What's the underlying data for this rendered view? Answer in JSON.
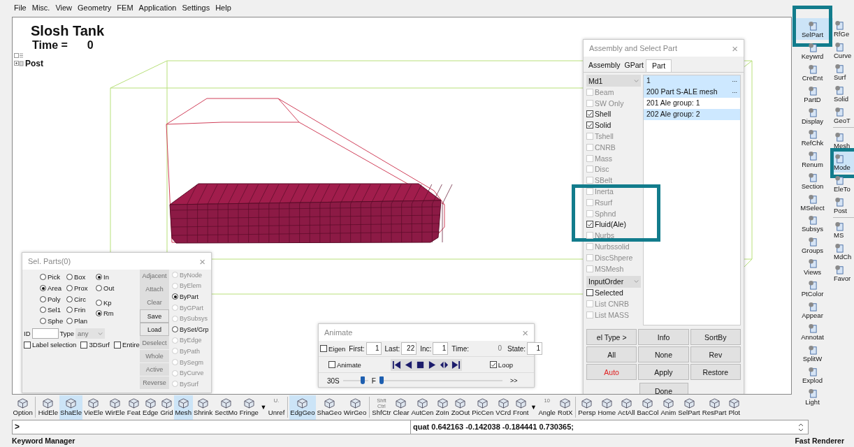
{
  "menu": [
    "File",
    "Misc.",
    "View",
    "Geometry",
    "FEM",
    "Application",
    "Settings",
    "Help"
  ],
  "viewport": {
    "title": "Slosh Tank",
    "time_label": "Time =",
    "time_value": "0",
    "tree_label": "Post"
  },
  "sel_parts": {
    "title": "Sel. Parts(0)",
    "close": "×",
    "methods": [
      {
        "label": "Pick",
        "selected": false
      },
      {
        "label": "Box",
        "selected": false
      },
      {
        "label": "Area",
        "selected": true
      },
      {
        "label": "Prox",
        "selected": false
      },
      {
        "label": "Poly",
        "selected": false
      },
      {
        "label": "Circ",
        "selected": false
      },
      {
        "label": "Sel1",
        "selected": false
      },
      {
        "label": "Frin",
        "selected": false
      },
      {
        "label": "Sphe",
        "selected": false
      },
      {
        "label": "Plan",
        "selected": false
      }
    ],
    "region": [
      {
        "label": "In",
        "selected": true
      },
      {
        "label": "Out",
        "selected": false
      }
    ],
    "keep": [
      {
        "label": "Kp",
        "selected": false
      },
      {
        "label": "Rm",
        "selected": true
      }
    ],
    "id_label": "ID",
    "type_label": "Type",
    "type_value": "any",
    "type_disabled": true,
    "checks": [
      {
        "label": "Label selection",
        "checked": false
      },
      {
        "label": "3DSurf",
        "checked": false
      },
      {
        "label": "Entire",
        "checked": false
      }
    ],
    "buttons": [
      {
        "label": "Adjacent",
        "disabled": true
      },
      {
        "label": "Attach",
        "disabled": true
      },
      {
        "label": "Clear",
        "disabled": true
      },
      {
        "label": "Save",
        "disabled": false
      },
      {
        "label": "Load",
        "disabled": false
      },
      {
        "label": "Deselect",
        "disabled": true
      },
      {
        "label": "Whole",
        "disabled": true
      },
      {
        "label": "Active",
        "disabled": true
      },
      {
        "label": "Reverse",
        "disabled": true
      }
    ],
    "by": [
      {
        "label": "ByNode",
        "selected": false,
        "disabled": true
      },
      {
        "label": "ByElem",
        "selected": false,
        "disabled": true
      },
      {
        "label": "ByPart",
        "selected": true,
        "disabled": false
      },
      {
        "label": "ByGPart",
        "selected": false,
        "disabled": true
      },
      {
        "label": "BySubsys",
        "selected": false,
        "disabled": true
      },
      {
        "label": "BySet/Grp",
        "selected": false,
        "disabled": false
      },
      {
        "label": "ByEdge",
        "selected": false,
        "disabled": true
      },
      {
        "label": "ByPath",
        "selected": false,
        "disabled": true
      },
      {
        "label": "BySegm",
        "selected": false,
        "disabled": true
      },
      {
        "label": "ByCurve",
        "selected": false,
        "disabled": true
      },
      {
        "label": "BySurf",
        "selected": false,
        "disabled": true
      }
    ]
  },
  "animate": {
    "title": "Animate",
    "close": "×",
    "eigen": {
      "label": "Eigen",
      "checked": false
    },
    "fields": [
      {
        "label": "First:",
        "value": "1",
        "disabled": false
      },
      {
        "label": "Last:",
        "value": "22",
        "disabled": false
      },
      {
        "label": "Inc:",
        "value": "1",
        "disabled": false
      },
      {
        "label": "Time:",
        "value": "0",
        "disabled": true
      },
      {
        "label": "State:",
        "value": "1",
        "disabled": false
      }
    ],
    "animate_check": {
      "label": "Animate",
      "checked": false
    },
    "loop": {
      "label": "Loop",
      "checked": true
    },
    "speed": {
      "label": "30S",
      "level": 0.85
    },
    "frame": {
      "label": "F",
      "level": 0.0
    },
    "more": ">>"
  },
  "assembly": {
    "title": "Assembly and Select Part",
    "close": "×",
    "tabs": [
      {
        "label": "Assembly",
        "selected": false
      },
      {
        "label": "GPart",
        "selected": false
      },
      {
        "label": "Part",
        "selected": true
      }
    ],
    "model": "Md1",
    "types": [
      {
        "label": "Beam",
        "checked": false,
        "disabled": true,
        "highlighted": false
      },
      {
        "label": "SW Only",
        "checked": false,
        "disabled": true,
        "highlighted": false
      },
      {
        "label": "Shell",
        "checked": true,
        "disabled": false,
        "highlighted": false
      },
      {
        "label": "Solid",
        "checked": true,
        "disabled": false,
        "highlighted": false
      },
      {
        "label": "Tshell",
        "checked": false,
        "disabled": true,
        "highlighted": false
      },
      {
        "label": "CNRB",
        "checked": false,
        "disabled": true,
        "highlighted": false
      },
      {
        "label": "Mass",
        "checked": false,
        "disabled": true,
        "highlighted": false
      },
      {
        "label": "Disc",
        "checked": false,
        "disabled": true,
        "highlighted": false
      },
      {
        "label": "SBelt",
        "checked": false,
        "disabled": true,
        "highlighted": false
      },
      {
        "label": "Inerta",
        "checked": false,
        "disabled": true,
        "highlighted": false
      },
      {
        "label": "Rsurf",
        "checked": false,
        "disabled": true,
        "highlighted": false
      },
      {
        "label": "Sphnd",
        "checked": false,
        "disabled": true,
        "highlighted": false
      },
      {
        "label": "Fluid(Ale)",
        "checked": true,
        "disabled": false,
        "highlighted": true
      },
      {
        "label": "Nurbs",
        "checked": false,
        "disabled": true,
        "highlighted": false
      },
      {
        "label": "Nurbssolid",
        "checked": false,
        "disabled": true,
        "highlighted": false
      },
      {
        "label": "DiscShpere",
        "checked": false,
        "disabled": true,
        "highlighted": false
      },
      {
        "label": "MSMesh",
        "checked": false,
        "disabled": true,
        "highlighted": false
      }
    ],
    "order": "InputOrder",
    "list_options": [
      {
        "label": "Selected",
        "checked": false,
        "disabled": false
      },
      {
        "label": "List CNRB",
        "checked": false,
        "disabled": true
      },
      {
        "label": "List MASS",
        "checked": false,
        "disabled": true
      }
    ],
    "parts": [
      {
        "label": "1",
        "more": "...",
        "selected": true
      },
      {
        "label": "200 Part S-ALE mesh",
        "more": "...",
        "selected": true
      },
      {
        "label": "201 Ale group: 1",
        "selected": false
      },
      {
        "label": "202 Ale group: 2",
        "selected": true
      }
    ],
    "buttons": [
      {
        "label": "el Type >",
        "alert": false
      },
      {
        "label": "Info",
        "alert": false
      },
      {
        "label": "SortBy",
        "alert": false
      },
      {
        "label": "All",
        "alert": false
      },
      {
        "label": "None",
        "alert": false
      },
      {
        "label": "Rev",
        "alert": false
      },
      {
        "label": "Auto",
        "alert": true
      },
      {
        "label": "Apply",
        "alert": false
      },
      {
        "label": "Restore",
        "alert": false
      }
    ],
    "done": "Done"
  },
  "side_toolbar": [
    [
      [
        {
          "label": "SelPart",
          "selected": true,
          "highlighted": true
        },
        {
          "label": "Keywrd",
          "selected": false,
          "highlighted": false
        },
        {
          "label": "CreEnt",
          "selected": false,
          "highlighted": false
        },
        {
          "label": "PartD",
          "selected": false,
          "highlighted": false
        },
        {
          "label": "Display",
          "selected": false,
          "highlighted": false
        },
        {
          "label": "RefChk",
          "selected": false,
          "highlighted": false
        },
        {
          "label": "Renum",
          "selected": false,
          "highlighted": false
        },
        {
          "label": "Section",
          "selected": false,
          "highlighted": false
        },
        {
          "label": "MSelect",
          "selected": false,
          "highlighted": false
        },
        {
          "label": "Subsys",
          "selected": false,
          "highlighted": false
        },
        {
          "label": "Groups",
          "selected": false,
          "highlighted": false
        },
        {
          "label": "Views",
          "selected": false,
          "highlighted": false
        },
        {
          "label": "PtColor",
          "selected": false,
          "highlighted": false
        },
        {
          "label": "Appear",
          "selected": false,
          "highlighted": false
        },
        {
          "label": "Annotat",
          "selected": false,
          "highlighted": false
        },
        {
          "label": "SplitW",
          "selected": false,
          "highlighted": false
        },
        {
          "label": "Explod",
          "selected": false,
          "highlighted": false
        },
        {
          "label": "Light",
          "selected": false,
          "highlighted": false
        }
      ]
    ],
    [
      [
        {
          "label": "RfGe",
          "selected": false,
          "highlighted": false
        },
        {
          "label": "Curve",
          "selected": false,
          "highlighted": false
        },
        {
          "label": "Surf",
          "selected": false,
          "highlighted": false
        },
        {
          "label": "Solid",
          "selected": false,
          "highlighted": false
        },
        {
          "label": "GeoT",
          "selected": false,
          "highlighted": false
        }
      ],
      [
        {
          "label": "Mesh",
          "selected": false,
          "highlighted": false
        },
        {
          "label": "Mode",
          "selected": true,
          "highlighted": true
        },
        {
          "label": "EleTo",
          "selected": false,
          "highlighted": false
        },
        {
          "label": "Post",
          "selected": false,
          "highlighted": false
        }
      ],
      [
        {
          "label": "MS",
          "selected": false,
          "highlighted": false
        },
        {
          "label": "MdCh",
          "selected": false,
          "highlighted": false
        },
        {
          "label": "Favor",
          "selected": false,
          "highlighted": false
        }
      ]
    ]
  ],
  "bottom_toolbar": [
    [
      {
        "kind": "tool",
        "label": "Option",
        "selected": false
      }
    ],
    [
      {
        "kind": "tool",
        "label": "HidEle",
        "selected": false
      },
      {
        "kind": "tool",
        "label": "ShaEle",
        "selected": true
      },
      {
        "kind": "tool",
        "label": "VieEle",
        "selected": false
      },
      {
        "kind": "tool",
        "label": "WirEle",
        "selected": false
      },
      {
        "kind": "tool",
        "label": "Feat",
        "selected": false
      },
      {
        "kind": "tool",
        "label": "Edge",
        "selected": false
      },
      {
        "kind": "tool",
        "label": "Grid",
        "selected": false
      },
      {
        "kind": "tool",
        "label": "Mesh",
        "selected": true
      },
      {
        "kind": "tool",
        "label": "Shrink",
        "selected": false
      },
      {
        "kind": "tool",
        "label": "SectMo",
        "selected": false
      },
      {
        "kind": "tool",
        "label": "Fringe",
        "selected": false
      },
      {
        "kind": "dropdown",
        "label": "▼",
        "selected": false
      },
      {
        "kind": "tool",
        "label": "Unref",
        "icon_text": "U.",
        "selected": false
      }
    ],
    [
      {
        "kind": "tool",
        "label": "EdgGeo",
        "selected": true
      },
      {
        "kind": "tool",
        "label": "ShaGeo",
        "selected": false
      },
      {
        "kind": "tool",
        "label": "WirGeo",
        "selected": false
      }
    ],
    [
      {
        "kind": "tool",
        "label": "ShfCtr",
        "icon_text": "Shft Ctrl",
        "selected": false
      },
      {
        "kind": "tool",
        "label": "Clear",
        "selected": false
      },
      {
        "kind": "tool",
        "label": "AutCen",
        "selected": false
      },
      {
        "kind": "tool",
        "label": "ZoIn",
        "selected": false
      },
      {
        "kind": "tool",
        "label": "ZoOut",
        "selected": false
      },
      {
        "kind": "tool",
        "label": "PicCen",
        "selected": false
      },
      {
        "kind": "tool",
        "label": "VCrd",
        "selected": false
      },
      {
        "kind": "tool",
        "label": "Front",
        "selected": false
      },
      {
        "kind": "dropdown",
        "label": "▼",
        "selected": false
      },
      {
        "kind": "tool",
        "label": "Angle",
        "icon_text": "10",
        "selected": false
      },
      {
        "kind": "tool",
        "label": "RotX",
        "selected": false
      }
    ],
    [
      {
        "kind": "tool",
        "label": "Persp",
        "selected": false
      },
      {
        "kind": "tool",
        "label": "Home",
        "selected": false
      },
      {
        "kind": "tool",
        "label": "ActAll",
        "selected": false
      },
      {
        "kind": "tool",
        "label": "BacCol",
        "selected": false
      },
      {
        "kind": "tool",
        "label": "Anim",
        "selected": false
      },
      {
        "kind": "tool",
        "label": "SelPart",
        "selected": false
      },
      {
        "kind": "tool",
        "label": "ResPart",
        "selected": false
      },
      {
        "kind": "tool",
        "label": "Plot",
        "selected": false
      }
    ]
  ],
  "command": {
    "prompt": ">",
    "value": "quat 0.642163 -0.142038 -0.184441 0.730365;"
  },
  "status": {
    "left": "Keyword Manager",
    "right": "Fast Renderer"
  }
}
